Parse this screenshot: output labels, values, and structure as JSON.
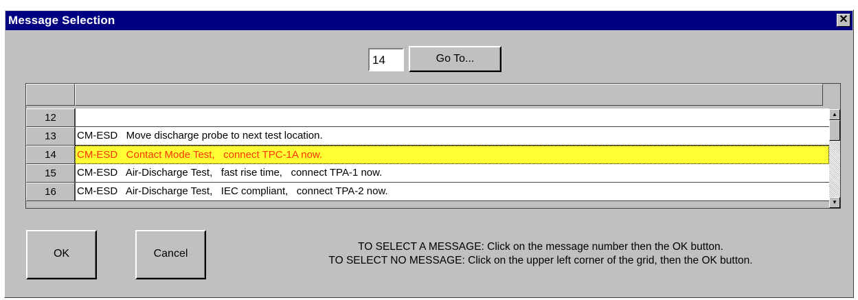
{
  "window": {
    "title": "Message Selection",
    "close_glyph": "✕"
  },
  "goto": {
    "value": "14",
    "button_label": "Go To..."
  },
  "grid": {
    "rows": [
      {
        "num": "12",
        "text": "",
        "selected": false
      },
      {
        "num": "13",
        "text": "CM-ESD   Move discharge probe to next test location.",
        "selected": false
      },
      {
        "num": "14",
        "text": "CM-ESD   Contact Mode Test,   connect TPC-1A now.",
        "selected": true
      },
      {
        "num": "15",
        "text": "CM-ESD   Air-Discharge Test,   fast rise time,   connect TPA-1 now.",
        "selected": false
      },
      {
        "num": "16",
        "text": "CM-ESD   Air-Discharge Test,   IEC compliant,   connect TPA-2 now.",
        "selected": false
      }
    ],
    "scroll_up_glyph": "▲",
    "scroll_down_glyph": "▼"
  },
  "buttons": {
    "ok_label": "OK",
    "cancel_label": "Cancel"
  },
  "instructions": {
    "line1": "TO SELECT A MESSAGE: Click on the message number then the OK button.",
    "line2": "TO SELECT NO MESSAGE: Click on the upper left corner of the grid, then the OK button."
  },
  "colors": {
    "title_bg": "#000080",
    "selected_row_bg": "#ffff33",
    "selected_row_text": "#ff3300",
    "face": "#c0c0c0"
  }
}
